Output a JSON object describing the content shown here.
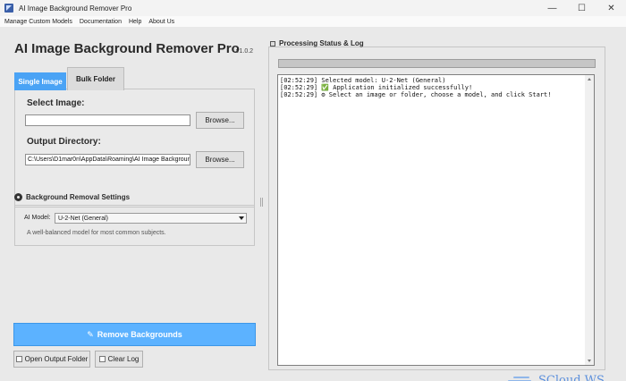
{
  "window": {
    "title": "AI Image Background Remover Pro",
    "controls": [
      "—",
      "☐",
      "✕"
    ]
  },
  "menu": [
    "Manage Custom Models",
    "Documentation",
    "Help",
    "About Us"
  ],
  "header": {
    "title": "AI Image Background Remover Pro",
    "version": "v1.0.2"
  },
  "tabs": [
    {
      "label": "Single Image",
      "active": true
    },
    {
      "label": "Bulk Folder",
      "active": false
    }
  ],
  "single": {
    "select_label": "Select Image:",
    "image_path": "",
    "browse1": "Browse...",
    "output_label": "Output Directory:",
    "output_path": "C:\\Users\\D1mar0n\\AppData\\Roaming\\AI Image Background",
    "browse2": "Browse..."
  },
  "settings": {
    "title": "Background Removal Settings",
    "model_label": "AI Model:",
    "model_value": "U-2-Net (General)",
    "description": "A well-balanced model for most common subjects."
  },
  "actions": {
    "remove": "Remove Backgrounds",
    "open_output": "Open Output Folder",
    "clear_log": "Clear Log"
  },
  "log": {
    "title": "Processing Status & Log",
    "progress": 0,
    "lines": [
      "[02:52:29] Selected model: U-2-Net (General)",
      "[02:52:29] ✅ Application initialized successfully!",
      "[02:52:29] ⚙ Select an image or folder, choose a model, and click Start!"
    ]
  },
  "watermark": "SCloud.WS",
  "colors": {
    "accent": "#4aa3f5",
    "remove_button": "#5cb2ff",
    "background": "#e9e9e9"
  }
}
